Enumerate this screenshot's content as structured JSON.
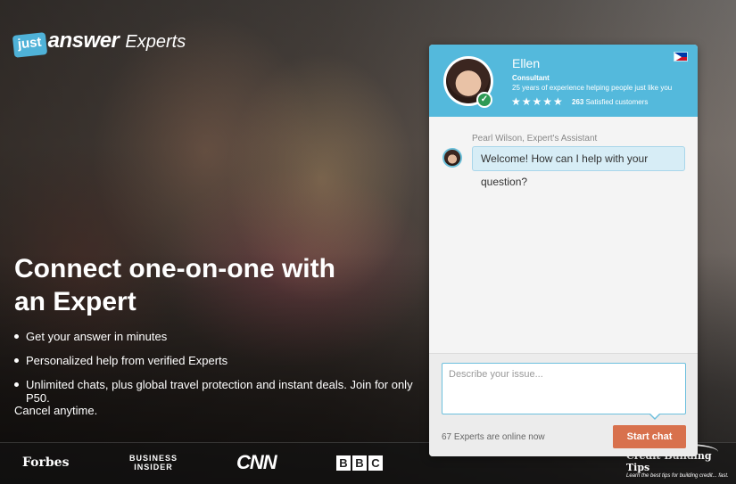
{
  "logo": {
    "just": "just",
    "answer": "answer",
    "experts": "Experts"
  },
  "hero": {
    "headline_line1": "Connect one-on-one with",
    "headline_line2": "an Expert",
    "bullets": [
      "Get your answer in minutes",
      "Personalized help from verified Experts",
      "Unlimited chats, plus global travel protection and instant deals. Join for only P50."
    ],
    "cancel_text": "Cancel anytime."
  },
  "press": {
    "forbes": "Forbes",
    "business_insider_line1": "BUSINESS",
    "business_insider_line2": "INSIDER",
    "cnn": "CNN",
    "bbc": [
      "B",
      "B",
      "C"
    ]
  },
  "watermark": {
    "title": "Credit Building Tips",
    "subtitle": "Learn the best tips for building credit... fast."
  },
  "chat": {
    "expert_name": "Ellen",
    "expert_role": "Consultant",
    "expert_experience": "25 years of experience helping people just like you",
    "stars": "★★★★★",
    "satisfied_count": "263",
    "satisfied_label": "Satisfied customers",
    "assistant_label": "Pearl Wilson, Expert's Assistant",
    "welcome_message": "Welcome! How can I help with your question?",
    "input_placeholder": "Describe your issue...",
    "online_status": "67 Experts are online now",
    "start_button": "Start chat",
    "icons": {
      "verified": "checkmark-icon",
      "flag": "philippines-flag-icon"
    }
  },
  "colors": {
    "header_blue": "#54b9dc",
    "button_orange": "#d8714d",
    "bubble_blue": "#d7edf6",
    "verified_green": "#2e9a55"
  }
}
